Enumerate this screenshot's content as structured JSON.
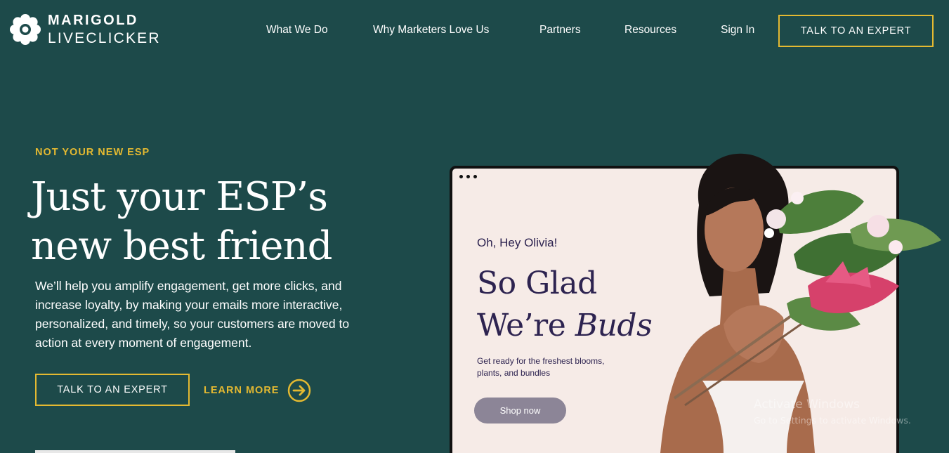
{
  "brand": {
    "name_top": "MARIGOLD",
    "name_bottom": "LIVECLICKER",
    "icon": "marigold-flower-icon"
  },
  "nav": {
    "items": [
      "What We Do",
      "Why Marketers Love Us",
      "Partners",
      "Resources",
      "Sign In"
    ],
    "cta": "TALK TO AN EXPERT"
  },
  "hero": {
    "eyebrow": "NOT YOUR NEW ESP",
    "headline_line1": "Just your ESP’s",
    "headline_line2": "new best friend",
    "body": "We’ll help you amplify engagement, get more clicks, and increase loyalty, by making your emails more interactive, personalized, and timely, so your customers are moved to action at every moment of engagement.",
    "cta_primary": "TALK TO AN EXPERT",
    "cta_secondary": "LEARN MORE",
    "cta_secondary_icon": "arrow-circle-right-icon"
  },
  "email_mock": {
    "greeting": "Oh, Hey Olivia!",
    "title_line1": "So Glad",
    "title_line2_plain": "We’re ",
    "title_line2_italic": "Buds",
    "subtitle": "Get ready for the freshest blooms, plants, and bundles",
    "button": "Shop now"
  },
  "watermark": {
    "line1": "Activate Windows",
    "line2": "Go to Settings to activate Windows."
  },
  "colors": {
    "background": "#1d4a4a",
    "accent": "#e4b931",
    "mock_bg": "#f6ebe7",
    "mock_text": "#2d2350",
    "mock_button": "#8c8597"
  }
}
